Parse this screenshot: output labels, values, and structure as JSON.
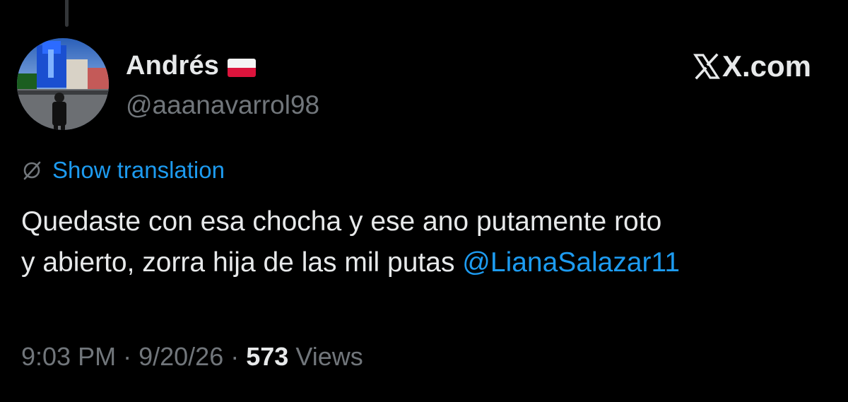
{
  "tweet": {
    "display_name": "Andrés",
    "flag_icon": "poland-flag-icon",
    "handle": "@aaanavarrol98",
    "site_brand": "X.com",
    "translate_label": "Show translation",
    "text_line1": "Quedaste con esa chocha y ese ano putamente roto",
    "text_line2": "y abierto, zorra hija de las mil putas",
    "mention": "@LianaSalazar11",
    "time": "9:03 PM",
    "separator": "·",
    "date": "9/20/26",
    "view_count": "573",
    "views_label": "Views"
  },
  "colors": {
    "background": "#000000",
    "text": "#e7e9ea",
    "secondary": "#71767b",
    "link": "#1d9bf0"
  }
}
